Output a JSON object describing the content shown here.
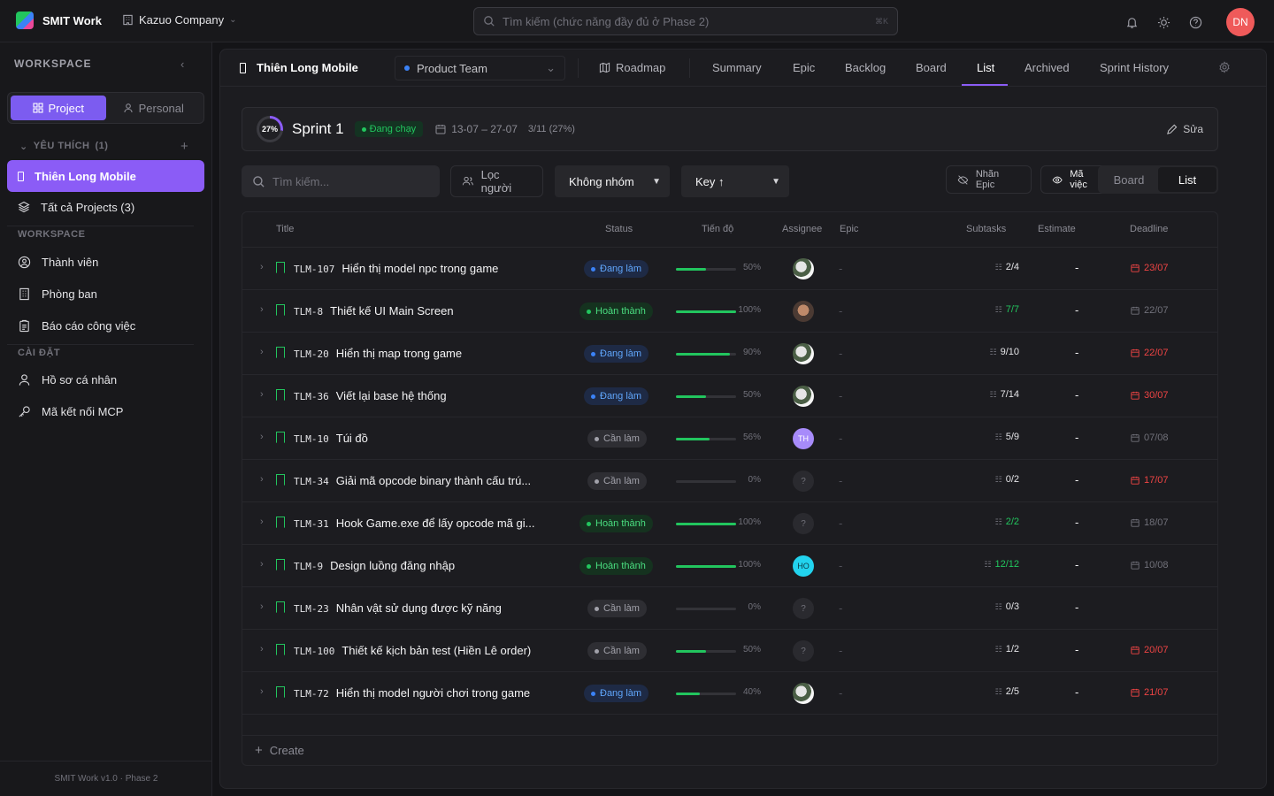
{
  "app": {
    "name": "SMIT Work",
    "company": "Kazuo Company"
  },
  "search": {
    "placeholder": "Tìm kiếm (chức năng đầy đủ ở Phase 2)",
    "shortcut": "⌘K"
  },
  "user": {
    "initials": "DN"
  },
  "sidebar": {
    "heading": "WORKSPACE",
    "segments": [
      "Project",
      "Personal"
    ],
    "favorites": {
      "label": "YÊU THÍCH",
      "count": "(1)"
    },
    "active_project": "Thiên Long Mobile",
    "all_projects": "Tất cả Projects (3)",
    "workspace_label": "WORKSPACE",
    "workspace_items": [
      "Thành viên",
      "Phòng ban",
      "Báo cáo công việc"
    ],
    "settings_label": "CÀI ĐẶT",
    "settings_items": [
      "Hồ sơ cá nhân",
      "Mã kết nối MCP"
    ],
    "footer": "SMIT Work v1.0 · Phase 2"
  },
  "project": {
    "title": "Thiên Long Mobile",
    "team": "Product Team",
    "tabs": [
      "Roadmap",
      "Summary",
      "Epic",
      "Backlog",
      "Board",
      "List",
      "Archived",
      "Sprint History"
    ],
    "active_tab": "List"
  },
  "sprint": {
    "progress_label": "27%",
    "progress": 0.27,
    "name": "Sprint 1",
    "status": "Đang chạy",
    "dates": "13-07 – 27-07",
    "summary": "3/11 (27%)",
    "edit": "Sửa"
  },
  "filters": {
    "search_placeholder": "Tìm kiếm...",
    "people": "Lọc người",
    "group": "Không nhóm",
    "sort": "Key ↑",
    "epic_label": "Nhãn Epic",
    "task_code": "Mã việc",
    "view_options": [
      "Board",
      "List"
    ],
    "active_view": "List"
  },
  "table": {
    "columns": [
      "Title",
      "Status",
      "Tiến độ",
      "Assignee",
      "Epic",
      "Subtasks",
      "Estimate",
      "Deadline"
    ],
    "rows": [
      {
        "key": "TLM-107",
        "title": "Hiển thị model npc trong game",
        "status": "Đang làm",
        "status_type": "doing",
        "progress": 50,
        "progress_label": "50%",
        "assignee": "img",
        "assignee_label": "",
        "epic": "-",
        "subtasks": "2/4",
        "subtasks_done": false,
        "estimate": "-",
        "deadline": "23/07",
        "overdue": true
      },
      {
        "key": "TLM-8",
        "title": "Thiết kế UI Main Screen",
        "status": "Hoàn thành",
        "status_type": "done",
        "progress": 100,
        "progress_label": "100%",
        "assignee": "img2",
        "assignee_label": "",
        "epic": "-",
        "subtasks": "7/7",
        "subtasks_done": true,
        "estimate": "-",
        "deadline": "22/07",
        "overdue": false
      },
      {
        "key": "TLM-20",
        "title": "Hiển thị map trong game",
        "status": "Đang làm",
        "status_type": "doing",
        "progress": 90,
        "progress_label": "90%",
        "assignee": "img",
        "assignee_label": "",
        "epic": "-",
        "subtasks": "9/10",
        "subtasks_done": false,
        "estimate": "-",
        "deadline": "22/07",
        "overdue": true
      },
      {
        "key": "TLM-36",
        "title": "Viết lại base hệ thống",
        "status": "Đang làm",
        "status_type": "doing",
        "progress": 50,
        "progress_label": "50%",
        "assignee": "img",
        "assignee_label": "",
        "epic": "-",
        "subtasks": "7/14",
        "subtasks_done": false,
        "estimate": "-",
        "deadline": "30/07",
        "overdue": true
      },
      {
        "key": "TLM-10",
        "title": "Túi đồ",
        "status": "Cần làm",
        "status_type": "todo",
        "progress": 56,
        "progress_label": "56%",
        "assignee": "th",
        "assignee_label": "TH",
        "epic": "-",
        "subtasks": "5/9",
        "subtasks_done": false,
        "estimate": "-",
        "deadline": "07/08",
        "overdue": false
      },
      {
        "key": "TLM-34",
        "title": "Giải mã opcode binary thành cấu trú...",
        "status": "Cần làm",
        "status_type": "todo",
        "progress": 0,
        "progress_label": "0%",
        "assignee": "q",
        "assignee_label": "?",
        "epic": "-",
        "subtasks": "0/2",
        "subtasks_done": false,
        "estimate": "-",
        "deadline": "17/07",
        "overdue": true
      },
      {
        "key": "TLM-31",
        "title": "Hook Game.exe để lấy opcode mã gi...",
        "status": "Hoàn thành",
        "status_type": "done",
        "progress": 100,
        "progress_label": "100%",
        "assignee": "q",
        "assignee_label": "?",
        "epic": "-",
        "subtasks": "2/2",
        "subtasks_done": true,
        "estimate": "-",
        "deadline": "18/07",
        "overdue": false
      },
      {
        "key": "TLM-9",
        "title": "Design luồng đăng nhập",
        "status": "Hoàn thành",
        "status_type": "done",
        "progress": 100,
        "progress_label": "100%",
        "assignee": "ho",
        "assignee_label": "HO",
        "epic": "-",
        "subtasks": "12/12",
        "subtasks_done": true,
        "estimate": "-",
        "deadline": "10/08",
        "overdue": false
      },
      {
        "key": "TLM-23",
        "title": "Nhân vật sử dụng được kỹ năng",
        "status": "Cần làm",
        "status_type": "todo",
        "progress": 0,
        "progress_label": "0%",
        "assignee": "q",
        "assignee_label": "?",
        "epic": "-",
        "subtasks": "0/3",
        "subtasks_done": false,
        "estimate": "-",
        "deadline": "",
        "overdue": false
      },
      {
        "key": "TLM-100",
        "title": "Thiết kế kịch bản test (Hiền Lê order)",
        "status": "Cần làm",
        "status_type": "todo",
        "progress": 50,
        "progress_label": "50%",
        "assignee": "q",
        "assignee_label": "?",
        "epic": "-",
        "subtasks": "1/2",
        "subtasks_done": false,
        "estimate": "-",
        "deadline": "20/07",
        "overdue": true
      },
      {
        "key": "TLM-72",
        "title": "Hiển thị model người chơi trong game",
        "status": "Đang làm",
        "status_type": "doing",
        "progress": 40,
        "progress_label": "40%",
        "assignee": "img",
        "assignee_label": "",
        "epic": "-",
        "subtasks": "2/5",
        "subtasks_done": false,
        "estimate": "-",
        "deadline": "21/07",
        "overdue": true
      }
    ],
    "create_label": "Create"
  }
}
